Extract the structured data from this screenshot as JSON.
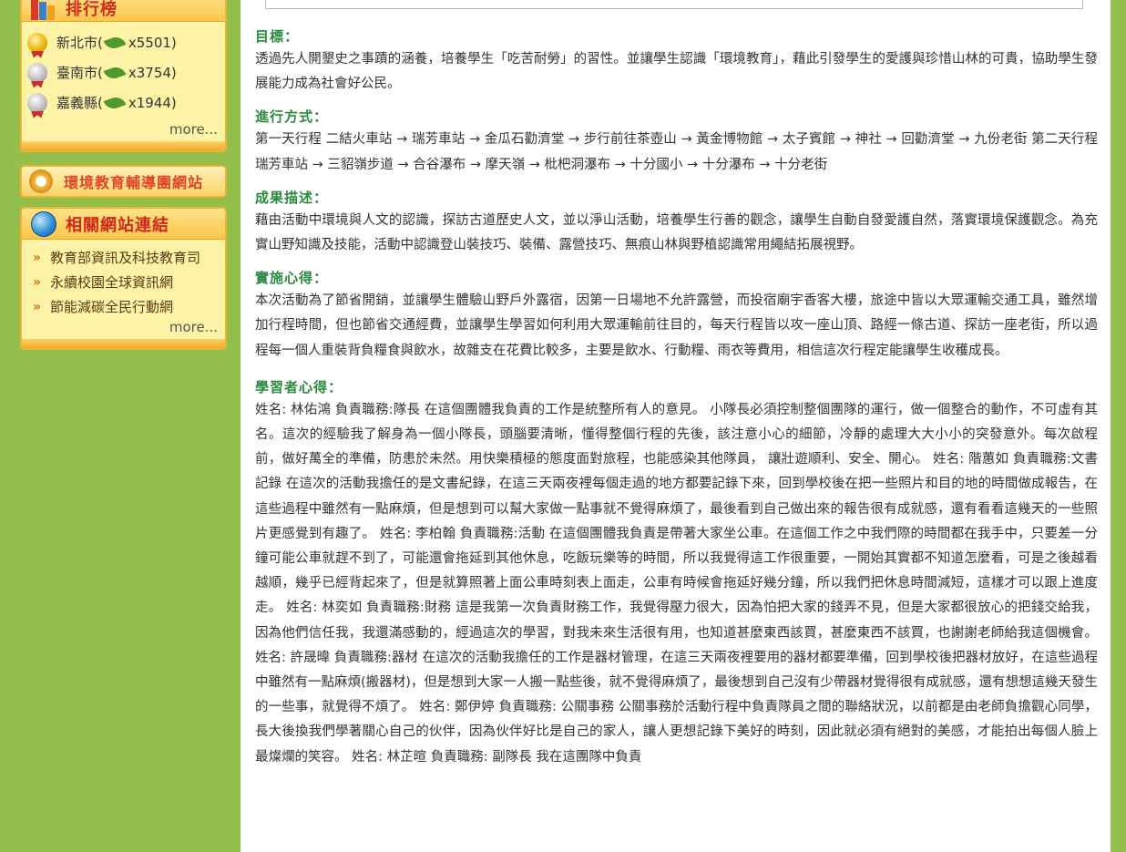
{
  "sidebar": {
    "ranking": {
      "title": "排行榜",
      "items": [
        {
          "name": "新北市",
          "open": "(",
          "count": "x5501)"
        },
        {
          "name": "臺南市",
          "open": "(",
          "count": "x3754)"
        },
        {
          "name": "嘉義縣",
          "open": "(",
          "count": "x1944)"
        }
      ],
      "more": "more..."
    },
    "banner": {
      "title": "環境教育輔導團網站"
    },
    "related": {
      "title": "相關網站連結",
      "links": [
        "教育部資訊及科技教育司",
        "永續校園全球資訊網",
        "節能減碳全民行動網"
      ],
      "more": "more..."
    }
  },
  "colors": {
    "accent_green": "#2a8a3d",
    "page_bg": "#95bf4c",
    "panel_bg": "#fdf3a7",
    "panel_border": "#f0b330"
  },
  "main": {
    "sections": [
      {
        "title": "目標：",
        "body": "透過先人開墾史之事蹟的涵養，培養學生「吃苦耐勞」的習性。並讓學生認識「環境教育」，藉此引發學生的愛護與珍惜山林的可貴，協助學生發展能力成為社會好公民。"
      },
      {
        "title": "進行方式：",
        "body": "第一天行程 二結火車站 → 瑞芳車站 → 金瓜石勸濟堂 → 步行前往茶壺山 → 黃金博物館 → 太子賓館 → 神社 → 回勸濟堂 → 九份老街 第二天行程 瑞芳車站 → 三貂嶺步道 → 合谷瀑布 → 摩天嶺 → 枇杷洞瀑布 → 十分國小 → 十分瀑布 → 十分老街"
      },
      {
        "title": "成果描述：",
        "body": "藉由活動中環境與人文的認識，探訪古道歷史人文，並以淨山活動，培養學生行善的觀念，讓學生自動自發愛護自然，落實環境保護觀念。為充實山野知識及技能，活動中認識登山裝技巧、裝備、露營技巧、無痕山林與野植認識常用繩結拓展視野。"
      },
      {
        "title": "實施心得：",
        "body": "本次活動為了節省開銷，並讓學生體驗山野戶外露宿，因第一日場地不允許露營，而投宿廟宇香客大樓，旅途中皆以大眾運輸交通工具，雖然增加行程時間，但也節省交通經費，並讓學生學習如何利用大眾運輸前往目的，每天行程皆以攻一座山頂、路經一條古道、探訪一座老街，所以過程每一個人重裝背負糧食與飲水，故雜支在花費比較多，主要是飲水、行動糧、雨衣等費用，相信這次行程定能讓學生收穫成長。"
      },
      {
        "title": "學習者心得：",
        "body": "姓名: 林佑鴻 負責職務:隊長 在這個團體我負責的工作是統整所有人的意見。 小隊長必須控制整個團隊的運行，做一個整合的動作，不可虛有其名。這次的經驗我了解身為一個小隊長，頭腦要清晰，懂得整個行程的先後，該注意小心的細節，冷靜的處理大大小小的突發意外。每次啟程前，做好萬全的準備，防患於未然。用快樂積極的態度面對旅程，也能感染其他隊員， 讓壯遊順利、安全、開心。 姓名: 階蕙如 負責職務:文書記錄 在這次的活動我擔任的是文書紀錄，在這三天兩夜裡每個走過的地方都要記錄下來，回到學校後在把一些照片和目的地的時間做成報告，在這些過程中雖然有一點麻煩，但是想到可以幫大家做一點事就不覺得麻煩了，最後看到自己做出來的報告很有成就感，還有看看這幾天的一些照片更感覺到有趣了。 姓名: 李柏翰 負責職務:活動 在這個團體我負責是帶著大家坐公車。在這個工作之中我們際的時間都在我手中，只要差一分鐘可能公車就趕不到了，可能還會拖延到其他休息，吃飯玩樂等的時間，所以我覺得這工作很重要，一開始其實都不知道怎麼看，可是之後越看越順，幾乎已經背起來了，但是就算照著上面公車時刻表上面走，公車有時候會拖延好幾分鐘，所以我們把休息時間減短，這樣才可以跟上進度走。 姓名: 林奕如 負責職務:財務 這是我第一次負責財務工作，我覺得壓力很大，因為怕把大家的錢弄不見，但是大家都很放心的把錢交給我，因為他們信任我，我還滿感動的，經過這次的學習，對我未來生活很有用，也知道甚麼東西該買，甚麼東西不該買，也謝謝老師給我這個機會。 姓名: 許晟暐 負責職務:器材 在這次的活動我擔任的工作是器材管理，在這三天兩夜裡要用的器材都要準備，回到學校後把器材放好，在這些過程中雖然有一點麻煩(搬器材)，但是想到大家一人搬一點些後，就不覺得麻煩了，最後想到自己沒有少帶器材覺得很有成就感，還有想想這幾天發生的一些事，就覺得不煩了。 姓名: 鄭伊婷 負責職務: 公關事務 公關事務於活動行程中負責隊員之間的聯絡狀況，以前都是由老師負擔觀心同學，長大後換我們學著關心自己的伙伴，因為伙伴好比是自己的家人，讓人更想記錄下美好的時刻，因此就必須有絕對的美感，才能拍出每個人臉上最燦爛的笑容。 姓名: 林芷暄 負責職務: 副隊長 我在這團隊中負責"
      }
    ]
  }
}
